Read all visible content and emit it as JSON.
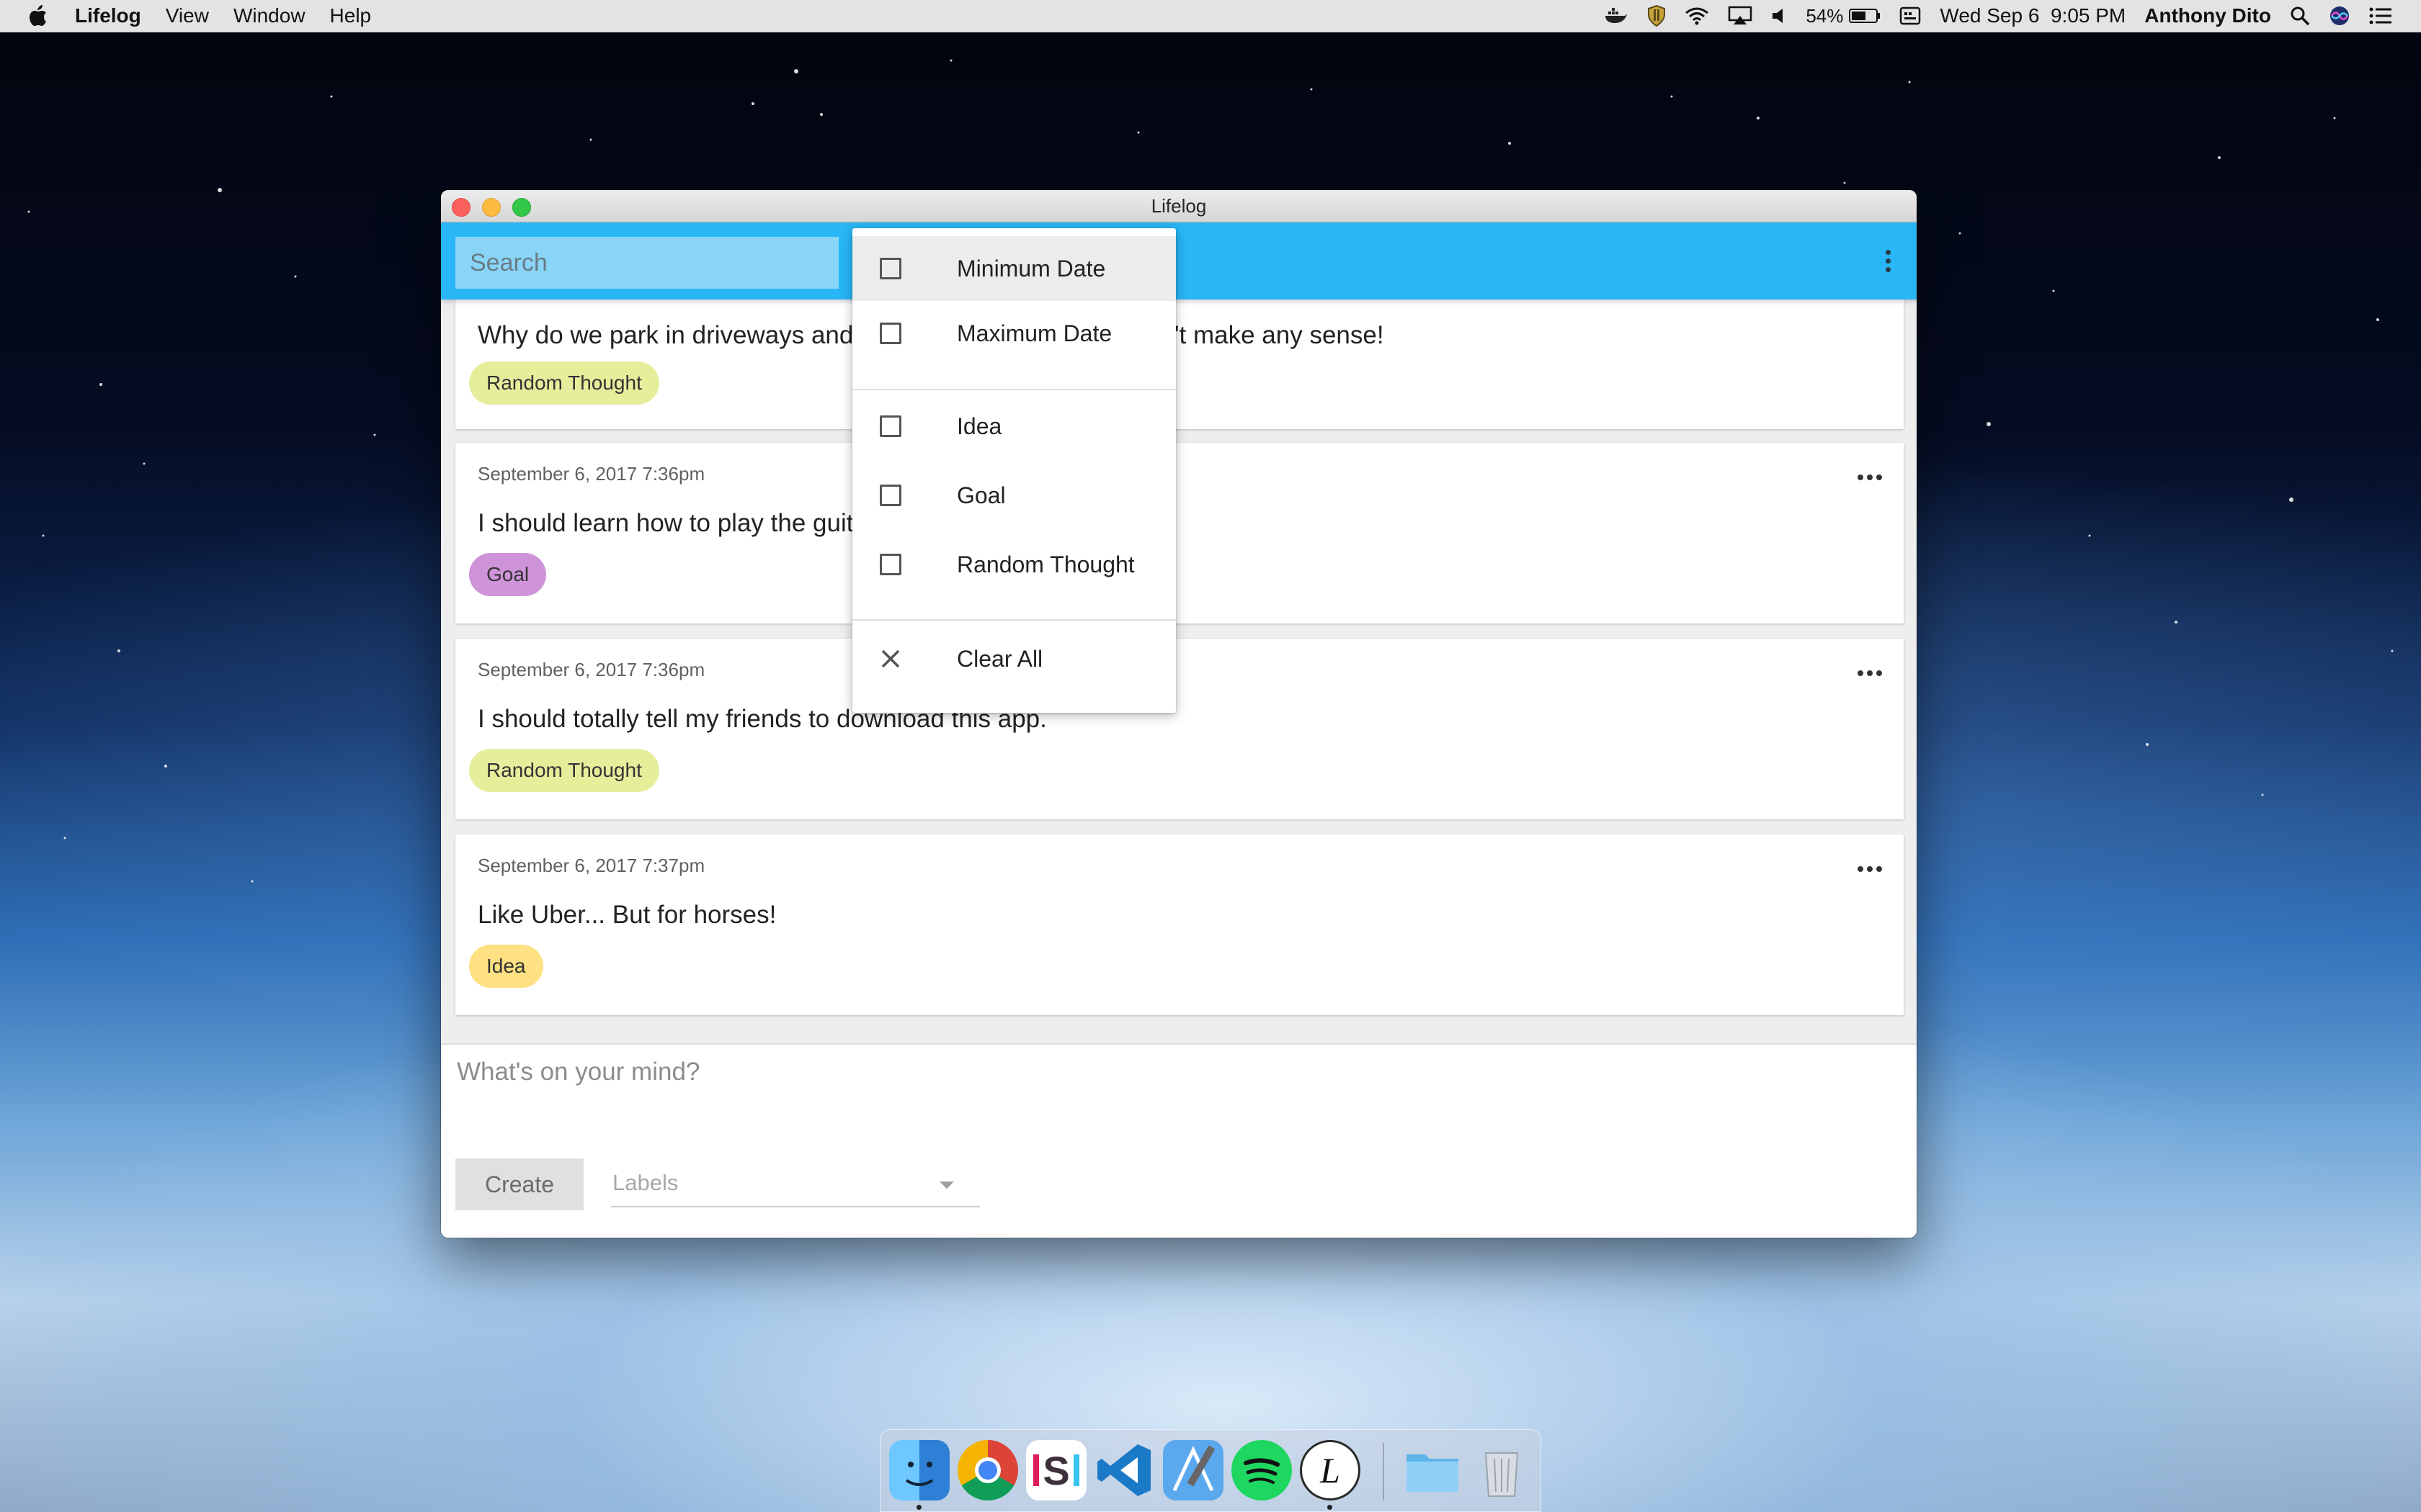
{
  "menubar": {
    "app_name": "Lifelog",
    "items": [
      "View",
      "Window",
      "Help"
    ],
    "battery": "54%",
    "datetime": "Wed Sep 6  9:05 PM",
    "user": "Anthony Dito"
  },
  "window": {
    "title": "Lifelog"
  },
  "toolbar": {
    "search_placeholder": "Search"
  },
  "entries": [
    {
      "date": "",
      "text": "Why do we park in driveways and drive on parkways? It doesn't make any sense!",
      "label": "Random Thought",
      "label_color": "#e6ee9c"
    },
    {
      "date": "September 6, 2017 7:36pm",
      "text": "I should learn how to play the guitar.",
      "label": "Goal",
      "label_color": "#ce93d8"
    },
    {
      "date": "September 6, 2017 7:36pm",
      "text": "I should totally tell my friends to download this app.",
      "label": "Random Thought",
      "label_color": "#e6ee9c"
    },
    {
      "date": "September 6, 2017 7:37pm",
      "text": "Like Uber... But for horses!",
      "label": "Idea",
      "label_color": "#ffe082"
    }
  ],
  "compose": {
    "placeholder": "What's on your mind?",
    "create_label": "Create",
    "labels_placeholder": "Labels"
  },
  "filter_menu": {
    "date_options": [
      "Minimum Date",
      "Maximum Date"
    ],
    "label_options": [
      "Idea",
      "Goal",
      "Random Thought"
    ],
    "clear_label": "Clear All"
  },
  "colors": {
    "toolbar": "#29b6f6",
    "search_field": "#89d5f8"
  },
  "dock": {
    "apps": [
      "finder-icon",
      "chrome-icon",
      "slack-icon",
      "vscode-icon",
      "xcode-icon",
      "spotify-icon",
      "lifelog-icon",
      "folder-icon",
      "trash-icon"
    ]
  }
}
